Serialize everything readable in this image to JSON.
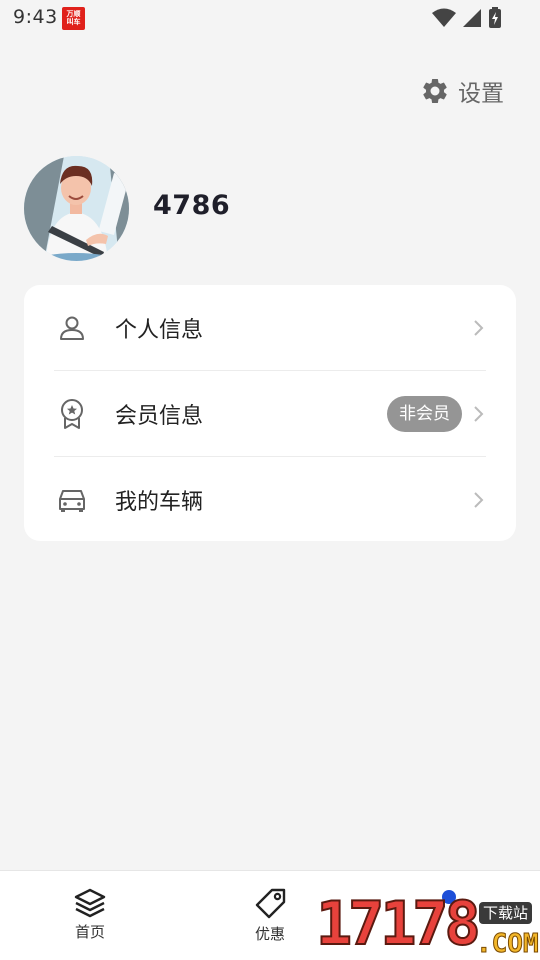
{
  "status_bar": {
    "time": "9:43",
    "app_badge": "万顺\n叫车"
  },
  "header": {
    "settings_label": "设置",
    "settings_icon": "gear-icon"
  },
  "profile": {
    "username": "4786",
    "avatar": "driver-avatar"
  },
  "menu": {
    "items": [
      {
        "label": "个人信息",
        "icon": "person-icon"
      },
      {
        "label": "会员信息",
        "icon": "medal-icon",
        "badge": "非会员"
      },
      {
        "label": "我的车辆",
        "icon": "car-icon"
      }
    ]
  },
  "bottom_nav": {
    "items": [
      {
        "label": "首页",
        "icon": "layers-icon"
      },
      {
        "label": "优惠",
        "icon": "tag-icon"
      }
    ]
  },
  "watermark": {
    "number": "17178",
    "domain": ".COM",
    "tag": "下载站"
  },
  "colors": {
    "background": "#f4f4f4",
    "card": "#ffffff",
    "badge": "#959595",
    "icon": "#666666"
  }
}
